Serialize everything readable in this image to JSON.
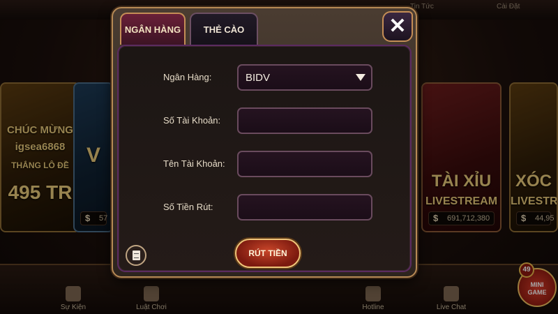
{
  "header": {
    "news_label": "Tin Tức",
    "settings_label": "Cài Đặt"
  },
  "background_cards": [
    {
      "title": "CHÚC MỪNG",
      "subtitle": "igsea6868",
      "note": "THẮNG LÔ ĐỀ",
      "amount_label": "495 TR"
    },
    {
      "title": "V",
      "subtitle": "",
      "note": "",
      "amount": "57"
    },
    {
      "title": "TÀI XỈU",
      "subtitle": "LIVESTREAM",
      "amount": "691,712,380"
    },
    {
      "title": "XÓC",
      "subtitle": "LIVESTR",
      "amount": "44,95"
    }
  ],
  "bottom_nav": {
    "items": [
      {
        "label": "Sự Kiện",
        "icon": "event-icon"
      },
      {
        "label": "Luật Chơi",
        "icon": "rules-icon"
      },
      {
        "label": "Hotline",
        "icon": "phone-icon"
      },
      {
        "label": "Live Chat",
        "icon": "chat-icon"
      }
    ],
    "mini_game": {
      "label_line1": "MINI",
      "label_line2": "GAME",
      "badge": "49"
    }
  },
  "dialog": {
    "tabs": [
      {
        "label": "NGÂN HÀNG",
        "active": true
      },
      {
        "label": "THẺ CÀO",
        "active": false
      }
    ],
    "close_symbol": "✕",
    "fields": {
      "bank": {
        "label": "Ngân Hàng:",
        "value": "BIDV"
      },
      "account_number": {
        "label": "Số Tài Khoản:",
        "value": ""
      },
      "account_name": {
        "label": "Tên Tài Khoản:",
        "value": ""
      },
      "amount": {
        "label": "Số Tiền Rút:",
        "value": ""
      }
    },
    "submit_label": "RÚT TIỀN"
  },
  "colors": {
    "dialog_border": "#b78a55",
    "active_tab": "#6a2038",
    "submit_button": "#c9462a"
  }
}
